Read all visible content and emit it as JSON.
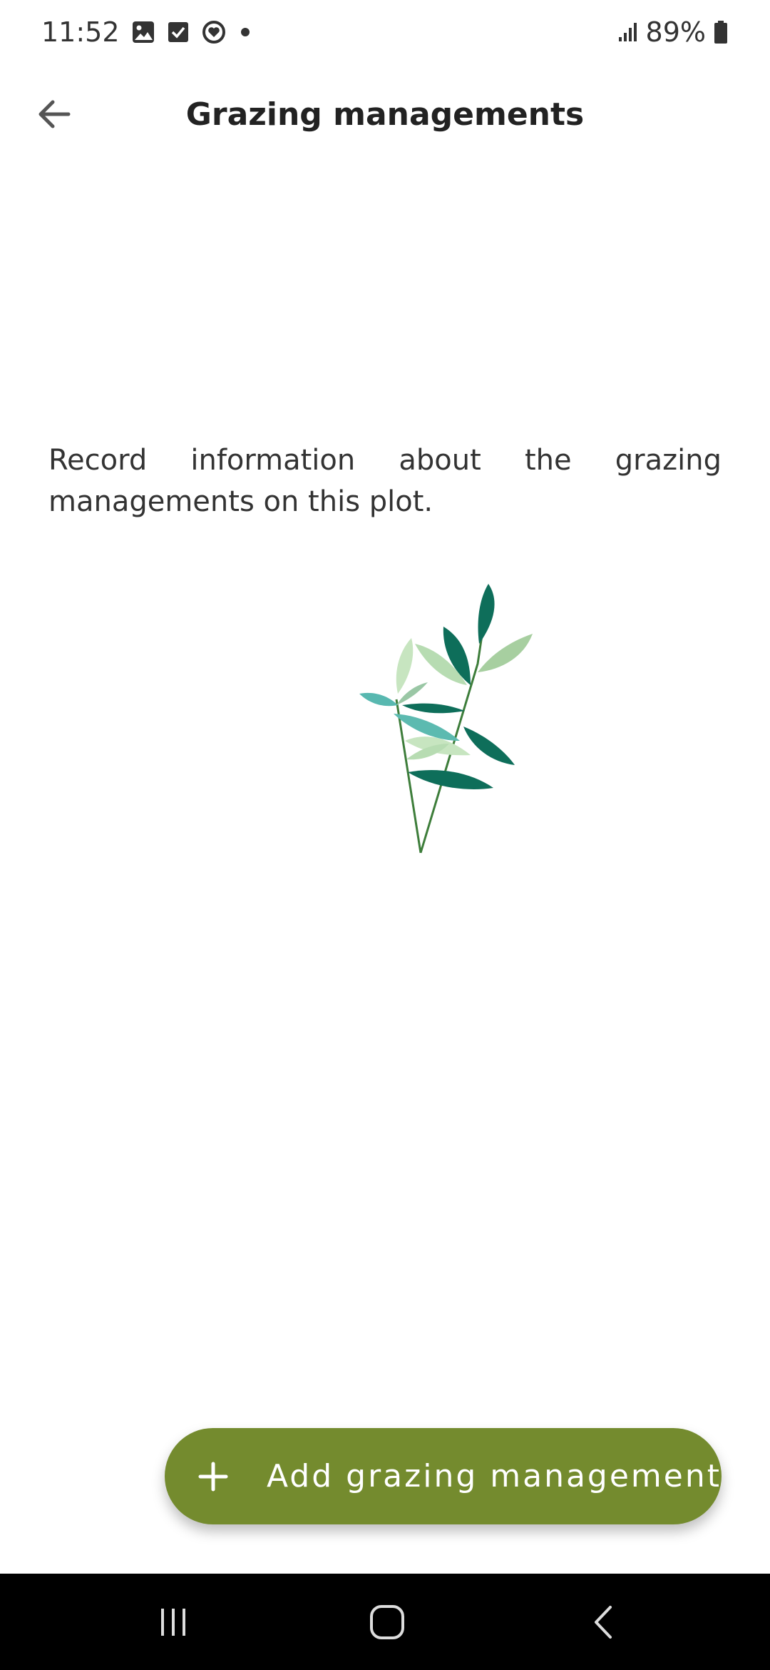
{
  "status_bar": {
    "time": "11:52",
    "battery": "89%",
    "icons": [
      "gallery-icon",
      "checkbox-icon",
      "heart-circle-icon",
      "dot-icon",
      "signal-icon",
      "battery-icon"
    ]
  },
  "app_bar": {
    "title": "Grazing managements",
    "back_icon": "arrow-back-icon"
  },
  "main": {
    "description": "Record information about the grazing managements on this plot.",
    "illustration": "leafy-branch-illustration"
  },
  "fab": {
    "label": "Add grazing management",
    "icon": "plus-icon",
    "color": "#748b2e"
  },
  "nav_bar": {
    "buttons": [
      "recents-icon",
      "home-icon",
      "back-icon"
    ]
  }
}
